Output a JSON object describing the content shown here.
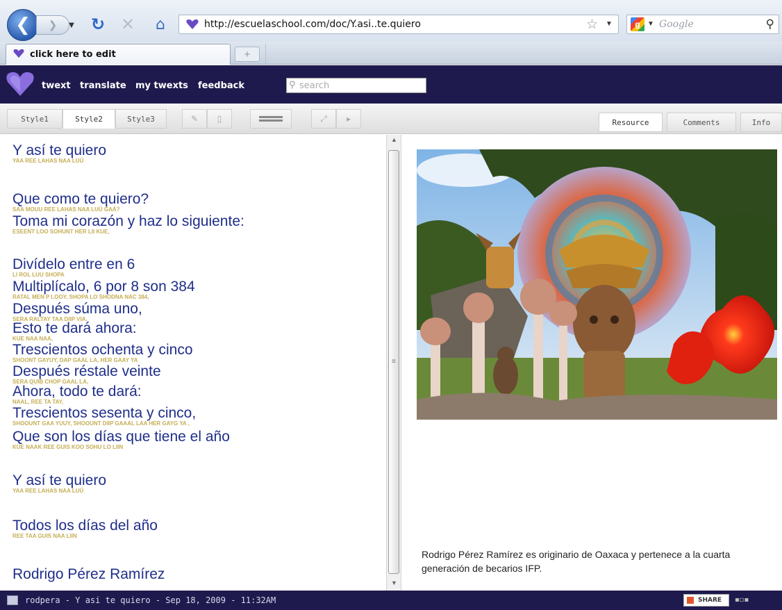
{
  "browser": {
    "url": "http://escuelaschool.com/doc/Y.asi..te.quiero",
    "search_placeholder": "Google",
    "tab_title": "click here to edit",
    "new_tab": "+",
    "icons": {
      "back": "back-arrow-icon",
      "forward": "forward-arrow-icon",
      "reload": "reload-icon",
      "stop": "stop-icon",
      "home": "home-icon",
      "bookmark": "star-icon",
      "search": "magnifier-icon"
    }
  },
  "app": {
    "nav": [
      "twext",
      "translate",
      "my twexts",
      "feedback"
    ],
    "search_placeholder": "search",
    "brand_color": "#1f1a4d",
    "text_color": "#1f2e8a",
    "twext_color": "#c5ae55"
  },
  "toolbar": {
    "styles": [
      "Style1",
      "Style2",
      "Style3"
    ],
    "active_style": "Style2",
    "panel_tabs": [
      "Resource",
      "Comments",
      "Info"
    ],
    "active_panel_tab": "Resource"
  },
  "document": {
    "lines": [
      {
        "text": "Y así te quiero",
        "twext": "YAA          REE LAHAS NAA LUÚ"
      },
      {
        "text": "Que como te quiero?",
        "twext": "SAA MOUU              REE LAHAS NAA LUÚ GAÁ?"
      },
      {
        "text": "Toma mi corazón y   haz lo siguiente:",
        "twext": "ESEENT   LOO SOHUNT          HER LII         KUE,"
      },
      {
        "text": "Divídelo entre en 6",
        "twext": "LI ROL         LUU              SHOPA"
      },
      {
        "text": "Multiplícalo, 6    por 8   son 384",
        "twext": "RATAL MEN P LOOY,      SHOPA LO SHODNA NAC     384,"
      },
      {
        "text": "Después súma uno,",
        "twext": "SERA              RALTAY TAA DIIP VIA,"
      },
      {
        "text": "Esto te dará ahora:",
        "twext": "KUE       NAA          NAA,"
      },
      {
        "text": "Trescientos ochenta y   cinco",
        "twext": "SHOONT GAYUY,        DAP GAAL LA,   HER GAAY YA"
      },
      {
        "text": "Después réstale veinte",
        "twext": "SERA              QUIB             CHOP GAAL LA,"
      },
      {
        "text": "Ahora, todo te dará:",
        "twext": "NAAL,          REE        TA   TAY,"
      },
      {
        "text": "Trescientos sesenta          y   cinco,",
        "twext": "SHOOUNT GAA YUUY,    SHOOUNT DIIP GAAAL LAA HER GAYG YA ,"
      },
      {
        "text": "Que son los días que tiene el año",
        "twext": "KUE       NAAK    REE   GUIS      KOO     SOHU         LO  LIIN"
      },
      {
        "text": "Y así te quiero",
        "twext": "YAA          REE LAHAS NAA LUÚ"
      },
      {
        "text": "Todos los días del año",
        "twext": "REE              TAA   GUIS         NAA    LIIN"
      },
      {
        "text": "Rodrigo Pérez Ramírez",
        "twext": ""
      }
    ]
  },
  "resource": {
    "caption": "Rodrigo Pérez Ramírez es originario de Oaxaca y pertenece a la cuarta generación de becarios IFP."
  },
  "status": {
    "text": "rodpera - Y asi te quiero - Sep 18, 2009 - 11:32AM",
    "share_label": "SHARE"
  }
}
